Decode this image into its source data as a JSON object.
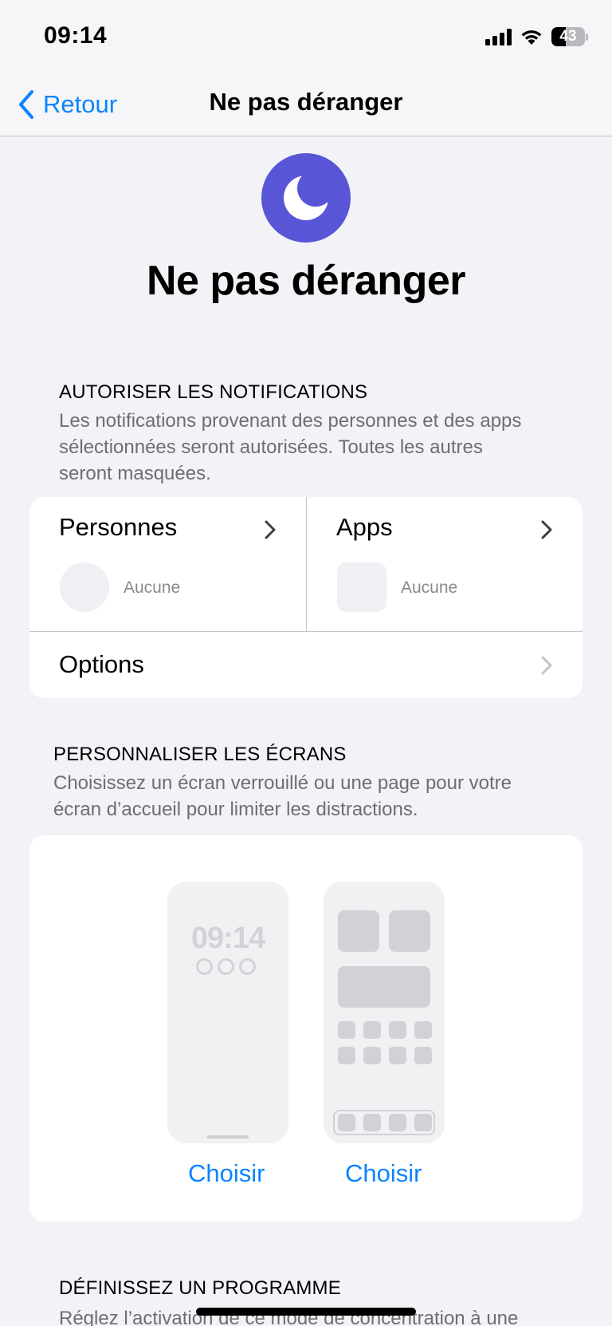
{
  "status_bar": {
    "time": "09:14",
    "battery_level": "43",
    "battery_fraction": 0.43
  },
  "nav": {
    "back_label": "Retour",
    "title": "Ne pas déranger"
  },
  "header": {
    "icon": "moon-icon",
    "title": "Ne pas déranger",
    "accent_color": "#5856d6"
  },
  "notifications": {
    "header": "AUTORISER LES NOTIFICATIONS",
    "footer_lines": [
      "Les notifications provenant des personnes et des apps",
      "sélectionnées seront autorisées. Toutes les autres",
      "seront masquées."
    ],
    "people": {
      "label": "Personnes",
      "value": "Aucune"
    },
    "apps": {
      "label": "Apps",
      "value": "Aucune"
    },
    "options_label": "Options"
  },
  "screens": {
    "header": "PERSONNALISER LES ÉCRANS",
    "footer_lines": [
      "Choisissez un écran verrouillé ou une page pour votre",
      "écran d’accueil pour limiter les distractions."
    ],
    "lock_screen_time": "09:14",
    "choose_lock_label": "Choisir",
    "choose_home_label": "Choisir"
  },
  "schedule": {
    "header": "DÉFINISSEZ UN PROGRAMME",
    "footer_partial": "Réglez l’activation de ce mode de concentration à une"
  },
  "colors": {
    "link": "#0a84ff",
    "background": "#f2f2f7"
  }
}
